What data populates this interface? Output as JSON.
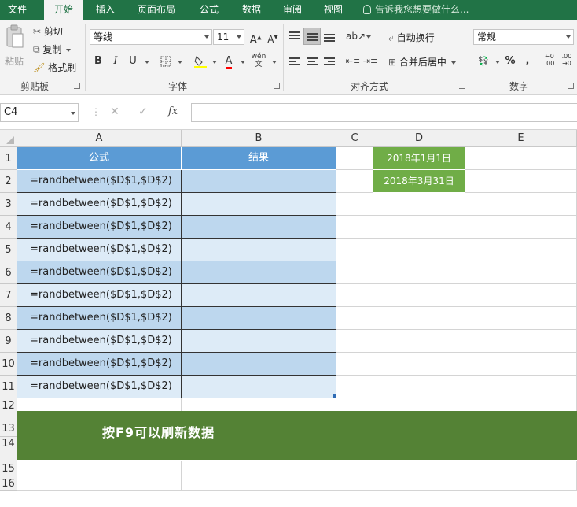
{
  "ribbon_tabs": [
    "文件",
    "开始",
    "插入",
    "页面布局",
    "公式",
    "数据",
    "审阅",
    "视图"
  ],
  "tell_me": "告诉我您想要做什么...",
  "clipboard": {
    "paste": "粘贴",
    "cut": "剪切",
    "copy": "复制",
    "format_painter": "格式刷",
    "group_label": "剪贴板"
  },
  "font": {
    "name": "等线",
    "size": "11",
    "bold": "B",
    "italic": "I",
    "underline": "U",
    "group_label": "字体"
  },
  "alignment": {
    "wrap_text": "自动换行",
    "merge_center": "合并后居中",
    "group_label": "对齐方式"
  },
  "number": {
    "format": "常规",
    "percent": "%",
    "comma": ",",
    "group_label": "数字"
  },
  "formula_bar": {
    "name_box": "C4",
    "fx": "fx",
    "cancel": "✕",
    "enter": "✓"
  },
  "sheet": {
    "columns": [
      "A",
      "B",
      "C",
      "D",
      "E"
    ],
    "rows": [
      "1",
      "2",
      "3",
      "4",
      "5",
      "6",
      "7",
      "8",
      "9",
      "10",
      "11",
      "12",
      "13",
      "14",
      "15",
      "16"
    ],
    "header_a": "公式",
    "header_b": "结果",
    "formulas": [
      "=randbetween($D$1,$D$2)",
      "=randbetween($D$1,$D$2)",
      "=randbetween($D$1,$D$2)",
      "=randbetween($D$1,$D$2)",
      "=randbetween($D$1,$D$2)",
      "=randbetween($D$1,$D$2)",
      "=randbetween($D$1,$D$2)",
      "=randbetween($D$1,$D$2)",
      "=randbetween($D$1,$D$2)",
      "=randbetween($D$1,$D$2)"
    ],
    "d1": "2018年1月1日",
    "d2": "2018年3月31日",
    "banner": "按F9可以刷新数据"
  },
  "colors": {
    "accent": "#217346",
    "table_header": "#5b9bd5",
    "row_light": "#ddebf7",
    "row_dark": "#bdd7ee",
    "date_fill": "#70ad47",
    "banner_fill": "#548235"
  }
}
